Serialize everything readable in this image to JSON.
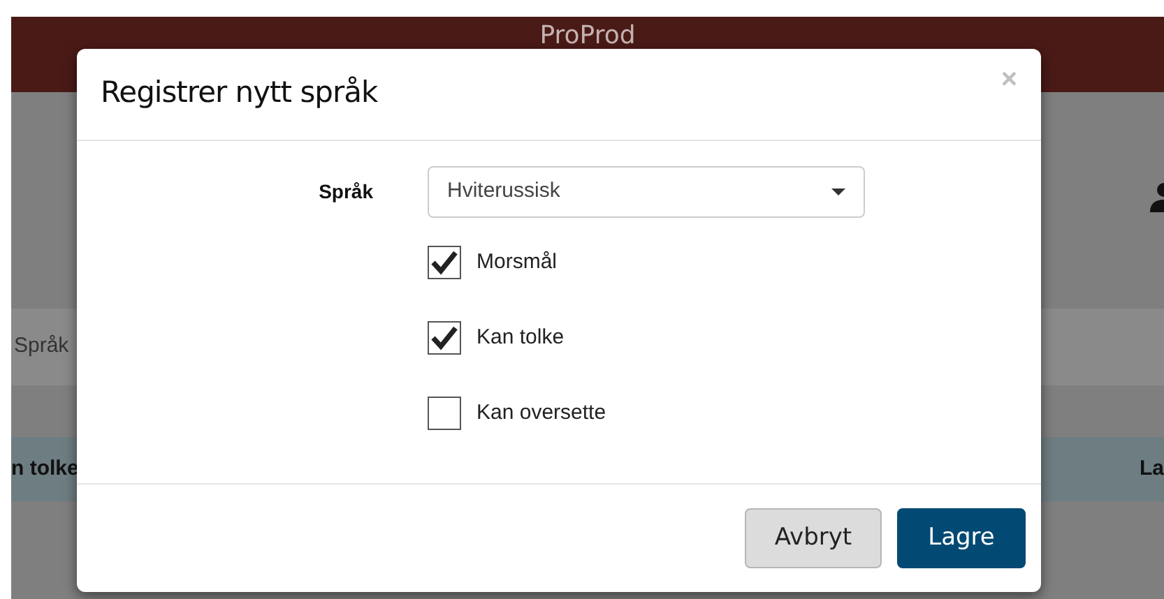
{
  "app_header": {
    "title": "ProProd"
  },
  "background": {
    "tab_label": "Språk",
    "table_header": [
      "n tolke",
      "La"
    ]
  },
  "dialog": {
    "title": "Registrer nytt språk",
    "close": "×",
    "language_field": {
      "label": "Språk",
      "value": "Hviterussisk"
    },
    "options": [
      {
        "label": "Morsmål",
        "checked": true
      },
      {
        "label": "Kan tolke",
        "checked": true
      },
      {
        "label": "Kan oversette",
        "checked": false
      }
    ],
    "buttons": [
      {
        "label": "Avbryt",
        "kind": "secondary"
      },
      {
        "label": "Lagre",
        "kind": "primary"
      }
    ]
  }
}
